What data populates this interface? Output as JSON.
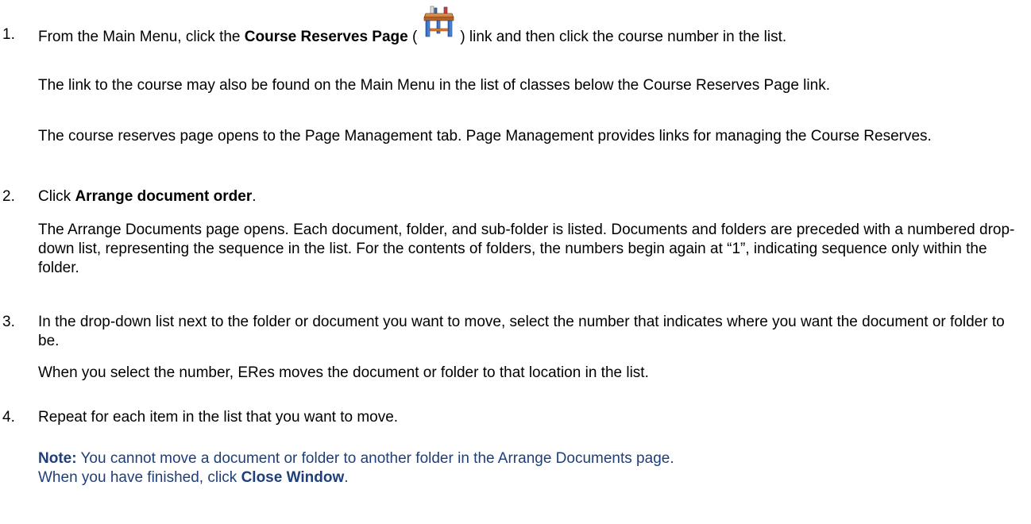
{
  "steps": [
    {
      "number": "1.",
      "line1_pre": "From the Main Menu, click the ",
      "line1_bold": "Course Reserves Page",
      "line1_paren_open": " (",
      "line1_icon": "course-reserves-desk-icon",
      "line1_post": ") link and then click the course number in the list.",
      "para2": "The link to the course may also be found on the Main Menu in the list of classes below the Course Reserves Page link.",
      "para3": "The course reserves page opens to the Page Management tab. Page Management provides links for managing the Course Reserves."
    },
    {
      "number": "2.",
      "line1_pre": "Click ",
      "line1_bold": "Arrange document order",
      "line1_post": ".",
      "para2": "The Arrange Documents page opens. Each document, folder, and sub-folder is listed. Documents and folders are preceded with a numbered drop-down list, representing the sequence in the list. For the contents of folders, the numbers begin again at “1”, indicating sequence only within the folder."
    },
    {
      "number": "3.",
      "line1": "In the drop-down list next to the folder or document you want to move, select the number that indicates where you want the document or folder to be.",
      "para2": "When you select the number, ERes moves the document or folder to that location in the list."
    },
    {
      "number": "4.",
      "line1": "Repeat for each item in the list that you want to move."
    }
  ],
  "note": {
    "label": "Note:",
    "text": " You cannot move a document or folder to another folder in the Arrange Documents page.",
    "line2_pre": "When you have finished, click ",
    "line2_bold": "Close Window",
    "line2_post": "."
  },
  "colors": {
    "note_text": "#1f3f7a",
    "body_text": "#000000"
  }
}
